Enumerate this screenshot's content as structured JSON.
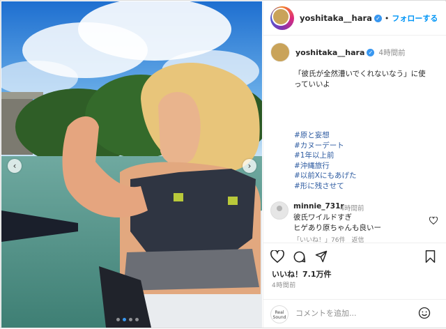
{
  "header": {
    "username": "yoshitaka__hara",
    "separator": "•",
    "follow_label": "フォローする"
  },
  "caption": {
    "username": "yoshitaka__hara",
    "time": "4時間前",
    "text_line1": "「彼氏が全然漕いでくれないなう」に使",
    "text_line2": "っていいよ",
    "hashtags": [
      "#原と妄想",
      "#カヌーデート",
      "#1年以上前",
      "#沖縄旅行",
      "#以前Xにもあげた",
      "#形に残させて"
    ]
  },
  "comment": {
    "username": "minnie_731r",
    "time": "4時間前",
    "line1": "彼氏ワイルドすぎ",
    "line2": "ヒゲあり原ちゃんも良いー",
    "meta": "「いいね！」76件　返信"
  },
  "actions": {
    "likes": "いいね！7.1万件",
    "time": "4時間前"
  },
  "comment_box": {
    "badge": "Real Sound",
    "placeholder": "コメントを追加..."
  },
  "colors": {
    "accent": "#0095f6",
    "hashtag": "#2c5aa0",
    "verified": "#3897f0"
  }
}
